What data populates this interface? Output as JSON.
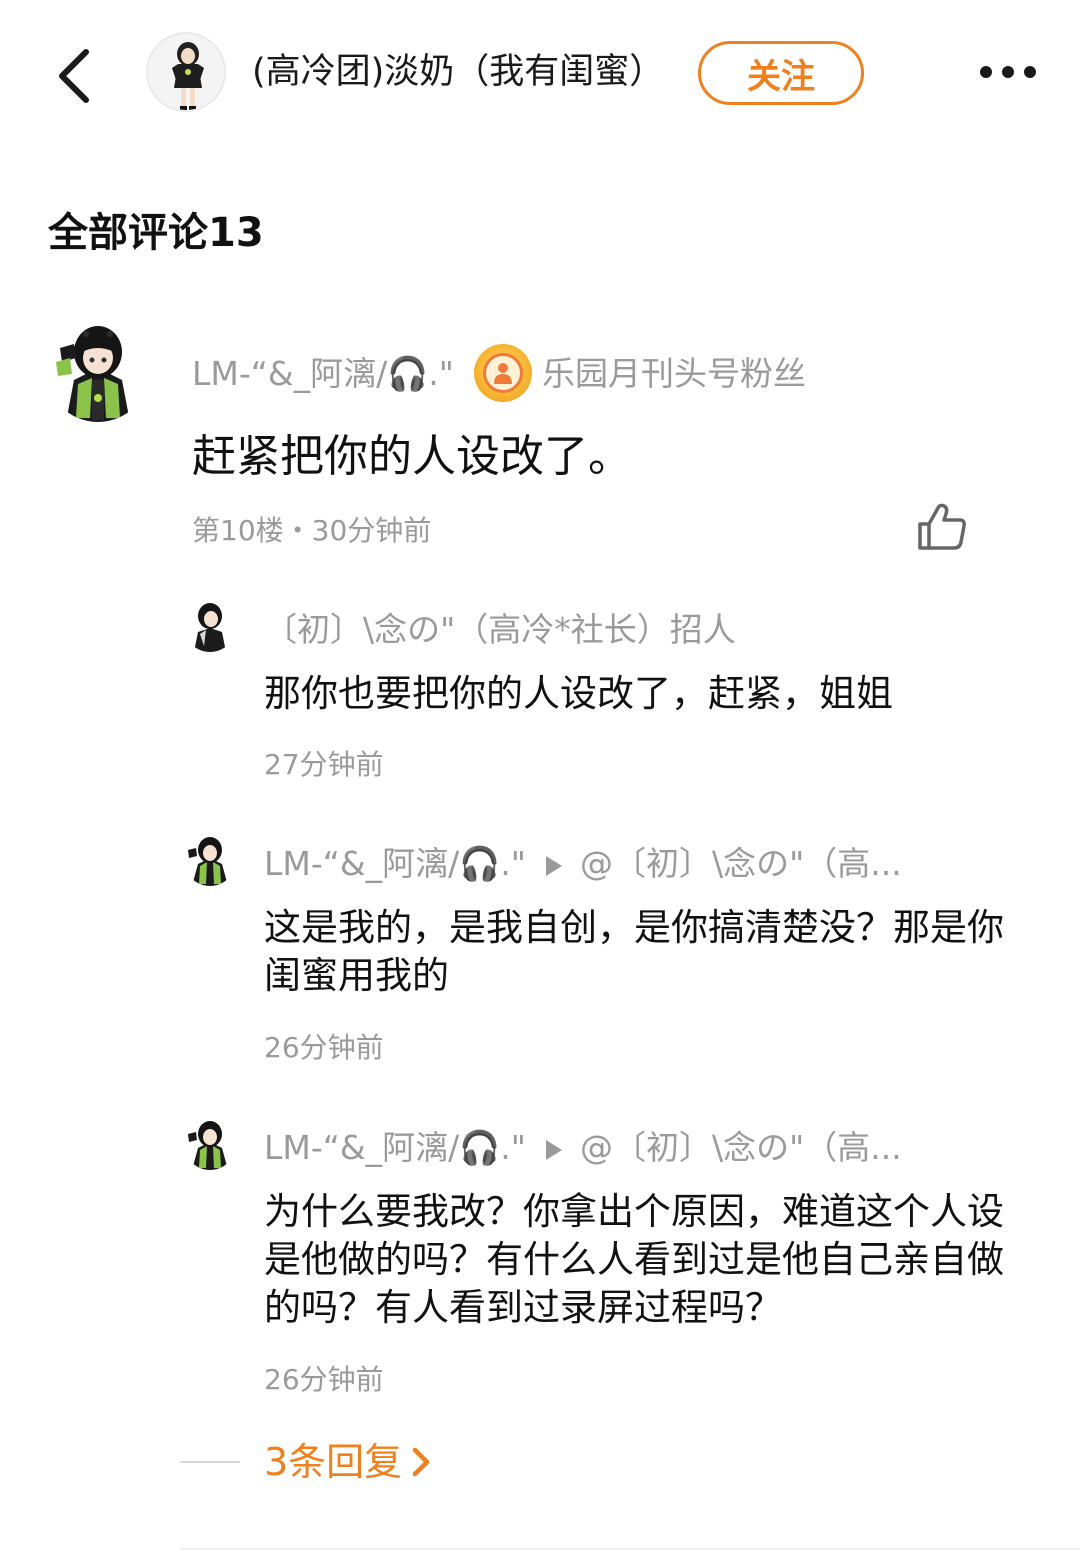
{
  "header": {
    "title": "(高冷团)淡奶（我有闺蜜）",
    "follow_label": "关注"
  },
  "section": {
    "title": "全部评论13"
  },
  "main_comment": {
    "username": "LM-“&_阿漓/🎧.\"",
    "badge_label": "乐园月刊头号粉丝",
    "content": "赶紧把你的人设改了。",
    "meta": "第10楼・30分钟前"
  },
  "replies": [
    {
      "username": "〔初〕\\念の\"（高冷*社长）招人",
      "mention": "",
      "content": "那你也要把你的人设改了，赶紧，姐姐",
      "time": "27分钟前"
    },
    {
      "username": "LM-“&_阿漓/🎧.\"",
      "mention": "@〔初〕\\念の\"（高...",
      "content": "这是我的，是我自创，是你搞清楚没？那是你闺蜜用我的",
      "time": "26分钟前"
    },
    {
      "username": "LM-“&_阿漓/🎧.\"",
      "mention": "@〔初〕\\念の\"（高...",
      "content": "为什么要我改？你拿出个原因，难道这个人设是他做的吗？有什么人看到过是他自己亲自做的吗？有人看到过录屏过程吗？",
      "time": "26分钟前"
    }
  ],
  "more_replies": {
    "label": "3条回复"
  },
  "colors": {
    "accent": "#f0801e",
    "meta_gray": "#9a9a9a",
    "text": "#111111"
  }
}
